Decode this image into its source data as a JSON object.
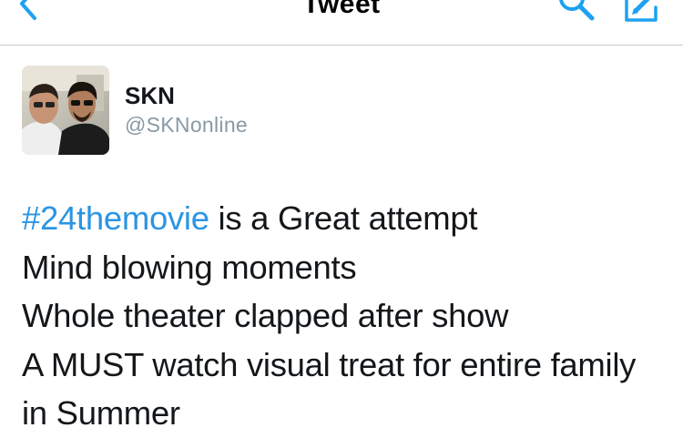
{
  "nav": {
    "title": "Tweet",
    "back_icon": "chevron-left-icon",
    "search_icon": "search-icon",
    "compose_icon": "compose-icon",
    "accent_color": "#1da1f2"
  },
  "tweet": {
    "author": {
      "display_name": "SKN",
      "handle": "@SKNonline"
    },
    "hashtag": "#24themovie",
    "hashtag_color": "#2b95e3",
    "lines": [
      " is a Great attempt",
      "Mind blowing moments",
      "Whole theater clapped after show",
      "A MUST watch visual treat for entire family",
      "in Summer"
    ]
  }
}
